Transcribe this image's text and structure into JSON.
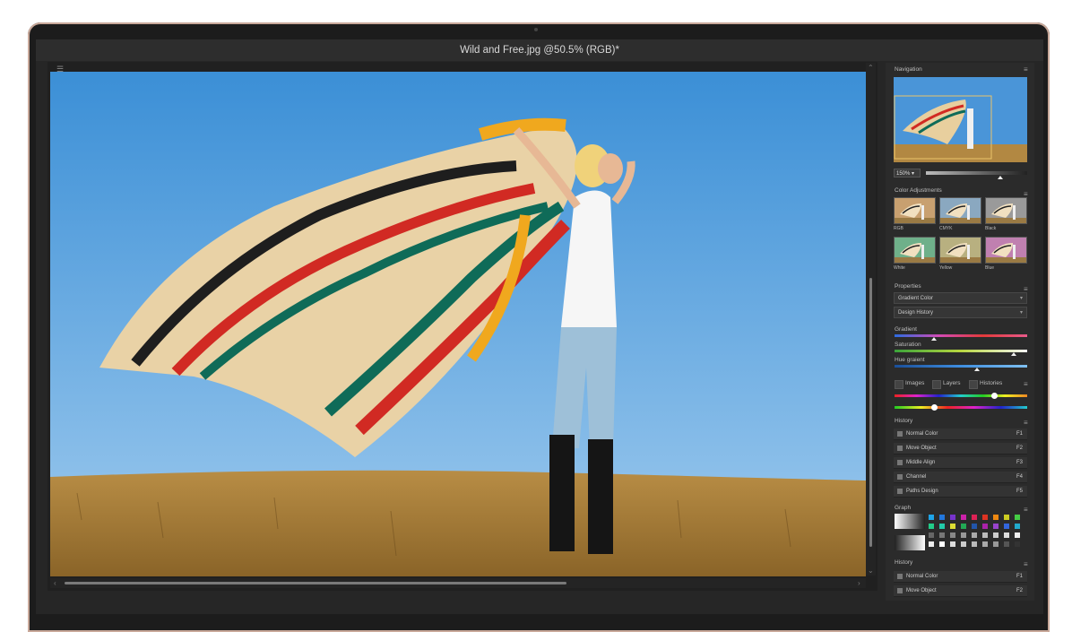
{
  "window": {
    "title": "Wild and Free.jpg @50.5% (RGB)*"
  },
  "navigation": {
    "title": "Navigation",
    "zoom": "150%"
  },
  "color_adjustments": {
    "title": "Color Adjustments",
    "items": [
      {
        "label": "RGB",
        "tint": "#c8a070"
      },
      {
        "label": "CMYK",
        "tint": "#8aa8c0"
      },
      {
        "label": "Black",
        "tint": "#9a9a9a"
      },
      {
        "label": "White",
        "tint": "#6fb08a"
      },
      {
        "label": "Yellow",
        "tint": "#b8b080"
      },
      {
        "label": "Blue",
        "tint": "#c080b0"
      }
    ]
  },
  "properties": {
    "title": "Properties",
    "dropdown1": "Gradient Color",
    "dropdown2": "Design History"
  },
  "gradient": {
    "label": "Gradient",
    "level": 0.3
  },
  "saturation": {
    "label": "Saturation",
    "level": 0.9
  },
  "hue_gradient": {
    "label": "Hue graient",
    "level": 0.62
  },
  "toggles": {
    "images": "Images",
    "layers": "Layers",
    "histories": "Histories"
  },
  "rainbow": {
    "level1": 0.75,
    "level2": 0.3
  },
  "history1": {
    "title": "History",
    "rows": [
      {
        "label": "Normal Color",
        "key": "F1"
      },
      {
        "label": "Move Object",
        "key": "F2"
      },
      {
        "label": "Middle Align",
        "key": "F3"
      },
      {
        "label": "Channel",
        "key": "F4"
      },
      {
        "label": "Paths Design",
        "key": "F5"
      }
    ]
  },
  "graph": {
    "title": "Graph"
  },
  "history2": {
    "title": "History",
    "rows": [
      {
        "label": "Normal Color",
        "key": "F1"
      },
      {
        "label": "Move Object",
        "key": "F2"
      }
    ]
  }
}
